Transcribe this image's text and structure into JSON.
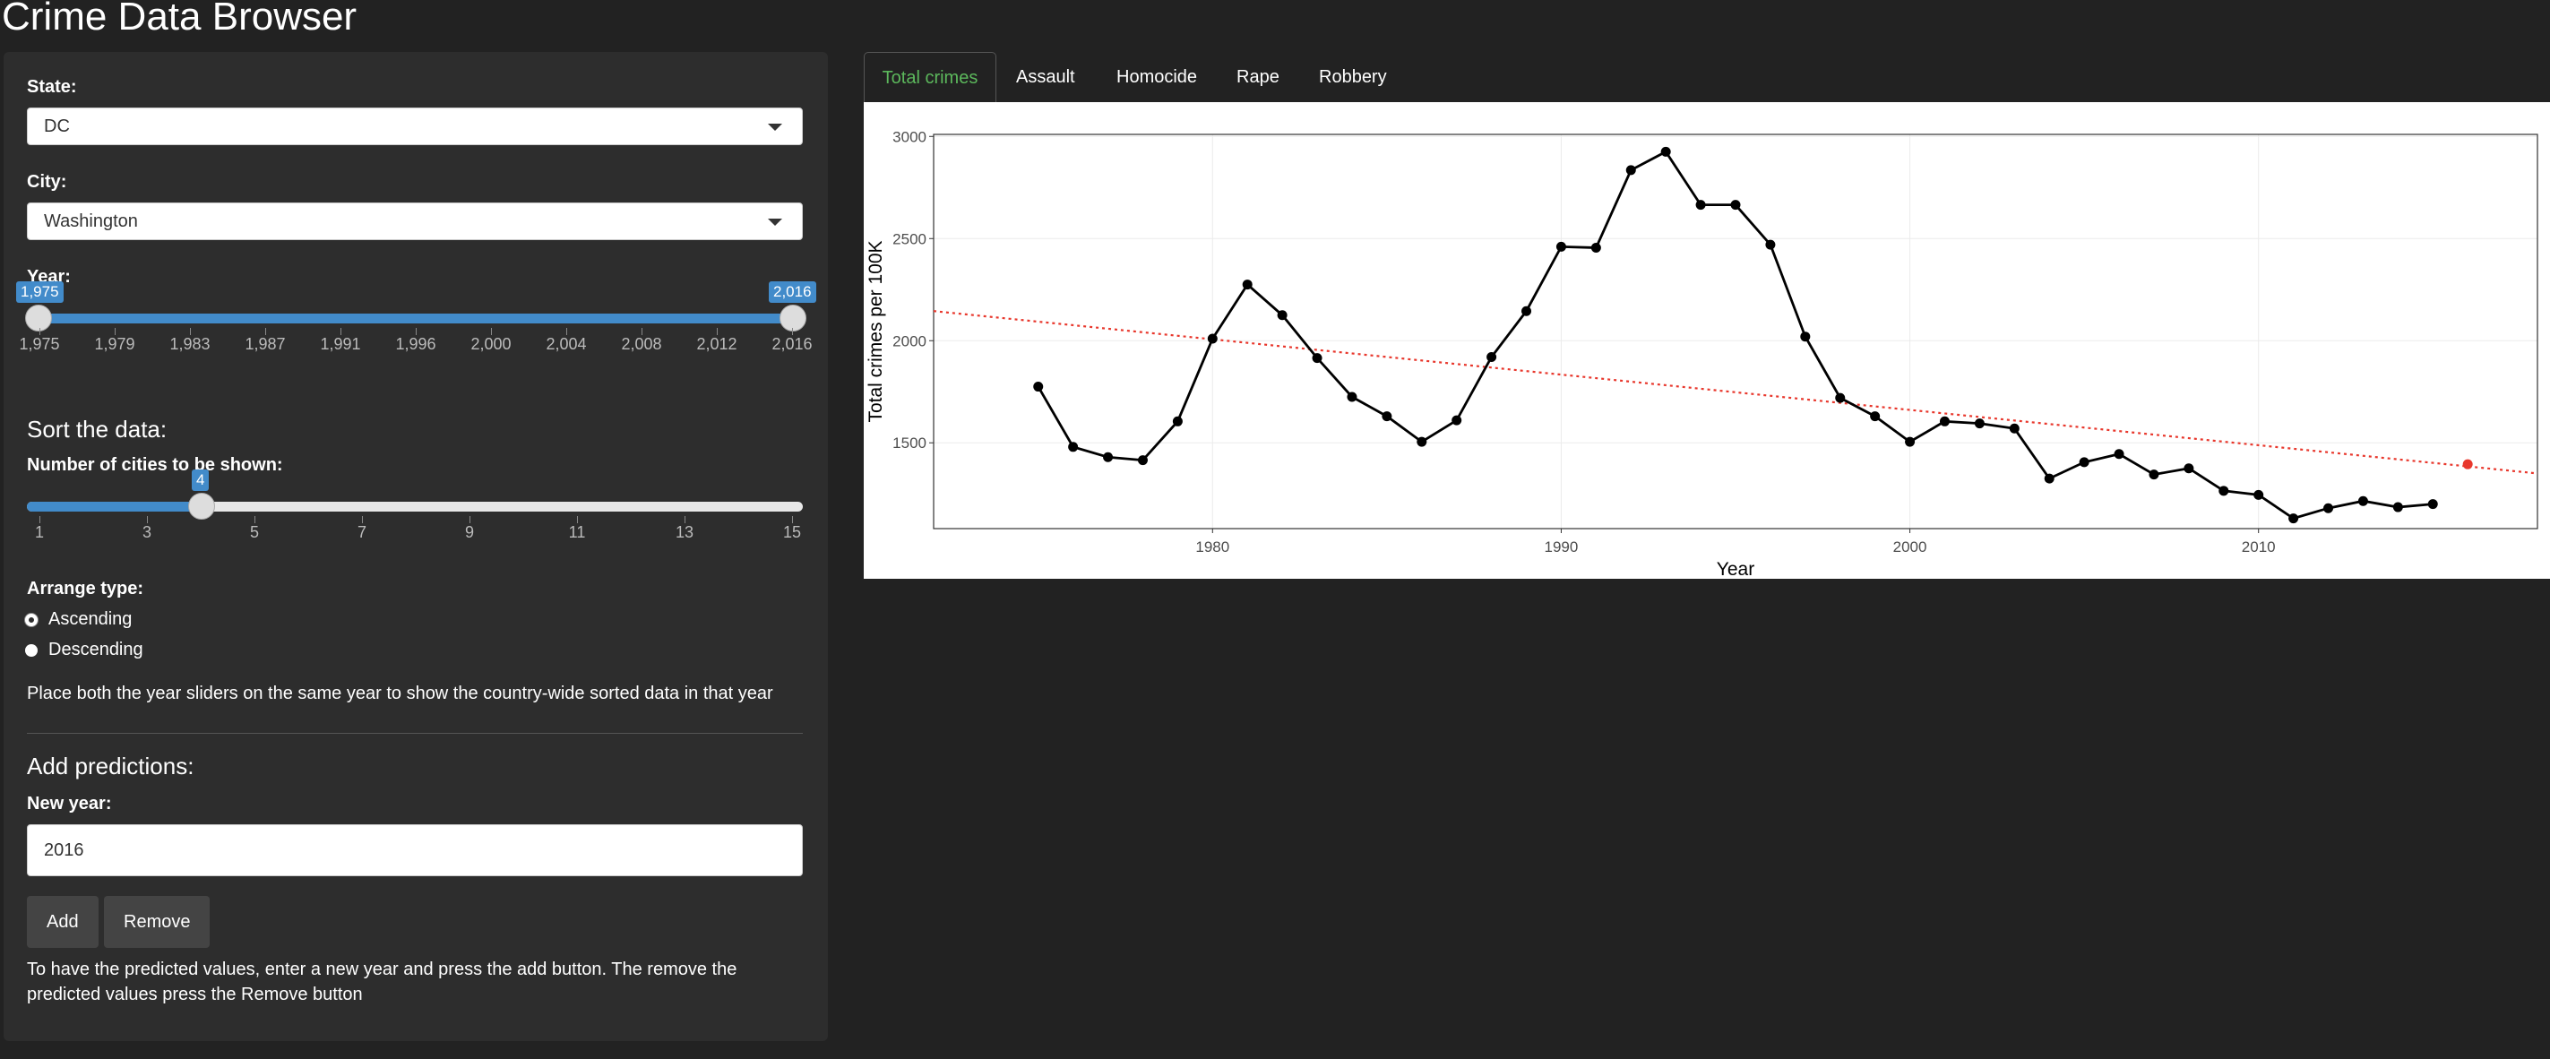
{
  "app": {
    "title": "Crime Data Browser"
  },
  "sidebar": {
    "state_label": "State:",
    "state_value": "DC",
    "city_label": "City:",
    "city_value": "Washington",
    "year_label": "Year:",
    "year_slider": {
      "min": 1975,
      "max": 2016,
      "low": 1975,
      "high": 2016,
      "low_label": "1,975",
      "high_label": "2,016",
      "ticks": [
        "1,975",
        "1,979",
        "1,983",
        "1,987",
        "1,991",
        "1,996",
        "2,000",
        "2,004",
        "2,008",
        "2,012",
        "2,016"
      ]
    },
    "sort_heading": "Sort the data:",
    "cities_label": "Number of cities to be shown:",
    "cities_slider": {
      "min": 1,
      "max": 15,
      "value": 4,
      "value_label": "4",
      "ticks": [
        "1",
        "3",
        "5",
        "7",
        "9",
        "11",
        "13",
        "15"
      ]
    },
    "arrange_label": "Arrange type:",
    "arrange_options": [
      "Ascending",
      "Descending"
    ],
    "arrange_selected": "Ascending",
    "note_text": "Place both the year sliders on the same year to show the country-wide sorted data in that year",
    "predictions_heading": "Add predictions:",
    "new_year_label": "New year:",
    "new_year_value": "2016",
    "add_button": "Add",
    "remove_button": "Remove",
    "help_text": "To have the predicted values, enter a new year and press the add button. The remove the predicted values press the Remove button"
  },
  "tabs": [
    "Total crimes",
    "Assault",
    "Homocide",
    "Rape",
    "Robbery"
  ],
  "active_tab": "Total crimes",
  "colors": {
    "accent": "#428bca",
    "active_tab": "#5cb85c",
    "trend": "#e8372c",
    "background": "#222222",
    "panel": "#2d2d2d"
  },
  "chart_data": {
    "type": "line",
    "xlabel": "Year",
    "ylabel": "Total crimes  per 100K",
    "xlim": [
      1972,
      2018
    ],
    "ylim": [
      1080,
      3010
    ],
    "x_ticks": [
      1980,
      1990,
      2000,
      2010
    ],
    "y_ticks": [
      1500,
      2000,
      2500,
      3000
    ],
    "grid": true,
    "series": [
      {
        "x": [
          1975,
          1976,
          1977,
          1978,
          1979,
          1980,
          1981,
          1982,
          1983,
          1984,
          1985,
          1986,
          1987,
          1988,
          1989,
          1990,
          1991,
          1992,
          1993,
          1994,
          1995,
          1996,
          1997,
          1998,
          1999,
          2000,
          2001,
          2002,
          2003,
          2004,
          2005,
          2006,
          2007,
          2008,
          2009,
          2010,
          2011,
          2012,
          2013,
          2014,
          2015
        ],
        "values": [
          1775,
          1480,
          1430,
          1415,
          1605,
          2010,
          2275,
          2125,
          1915,
          1725,
          1630,
          1505,
          1610,
          1920,
          2145,
          2460,
          2455,
          2835,
          2925,
          2665,
          2665,
          2470,
          2020,
          1720,
          1630,
          1505,
          1605,
          1595,
          1570,
          1325,
          1405,
          1445,
          1345,
          1375,
          1265,
          1245,
          1130,
          1180,
          1215,
          1185,
          1200
        ]
      },
      {
        "x": [
          1972,
          2018
        ],
        "values": [
          2145,
          1350
        ],
        "style": "dotted"
      }
    ],
    "prediction": {
      "x": 2016,
      "value": 1395
    }
  }
}
